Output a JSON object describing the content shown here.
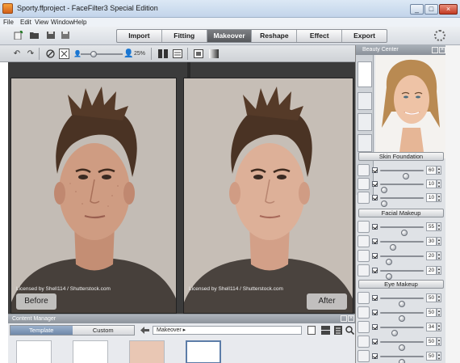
{
  "window": {
    "title": "Sporty.ffproject - FaceFilter3 Special Edition",
    "min": "_",
    "max": "□",
    "close": "×"
  },
  "menu": [
    "File",
    "Edit",
    "View",
    "Window",
    "Help"
  ],
  "tabs": [
    {
      "label": "Import",
      "active": false
    },
    {
      "label": "Fitting",
      "active": false
    },
    {
      "label": "Makeover",
      "active": true
    },
    {
      "label": "Reshape",
      "active": false
    },
    {
      "label": "Effect",
      "active": false
    },
    {
      "label": "Export",
      "active": false
    }
  ],
  "editor": {
    "zoom": "25%",
    "zoom_level": 0.3
  },
  "viewer": {
    "before_label": "Before",
    "after_label": "After",
    "license_left": "Licensed by Shell114 / Shutterstock.com",
    "license_right": "Licensed by Shell114 / Shutterstock.com"
  },
  "content_manager": {
    "title": "Content Manager",
    "tabs": [
      {
        "label": "Template",
        "active": true
      },
      {
        "label": "Custom",
        "active": false
      }
    ],
    "breadcrumb": "Makeover ▸"
  },
  "beauty_center": {
    "title": "Beauty Center",
    "skin_foundation": {
      "label": "Skin Foundation",
      "rows": [
        {
          "icon": "foundation-brush-icon",
          "value": 60
        },
        {
          "icon": "face-spots-icon",
          "value": 10
        },
        {
          "icon": "face-shine-icon",
          "value": 10
        }
      ]
    },
    "facial_makeup": {
      "label": "Facial Makeup",
      "rows": [
        {
          "icon": "cheek-blush-icon",
          "value": 55
        },
        {
          "icon": "face-contour-icon",
          "value": 30
        },
        {
          "icon": "lips-icon",
          "value": 20
        },
        {
          "icon": "lip-gloss-icon",
          "value": 20
        }
      ]
    },
    "eye_makeup": {
      "label": "Eye Makeup",
      "rows": [
        {
          "icon": "eyeshadow-icon",
          "value": 50
        },
        {
          "icon": "eyeliner-icon",
          "value": 50
        },
        {
          "icon": "eyelash-icon",
          "value": 34
        },
        {
          "icon": "eyebrow-icon",
          "value": 50
        },
        {
          "icon": "eye-color-icon",
          "value": 50
        }
      ]
    }
  },
  "colors": {
    "active_tab": "#6a6c70",
    "panel_bg": "#dfe2e6",
    "viewer_bg": "#3b3b3b"
  }
}
